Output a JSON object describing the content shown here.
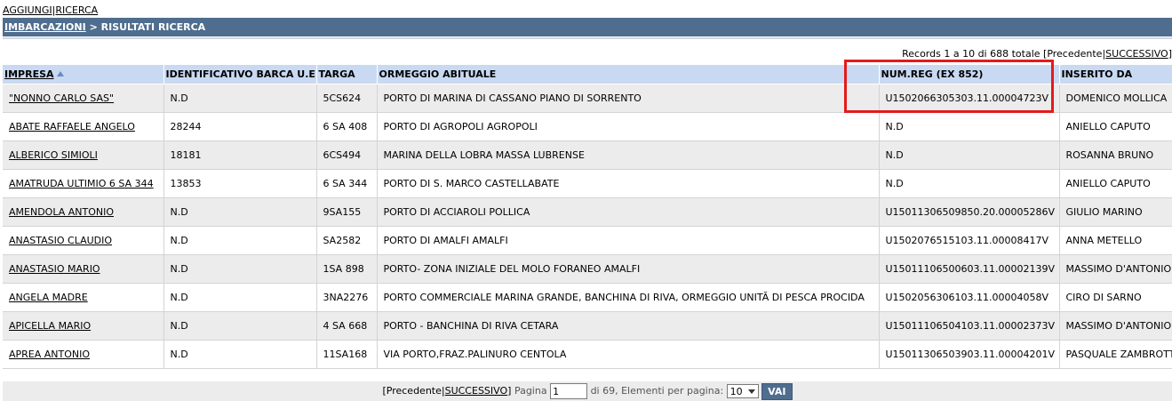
{
  "top_links": {
    "add": "AGGIUNGI",
    "search": "RICERCA"
  },
  "header": {
    "section": "IMBARCAZIONI",
    "separator": ">",
    "title": "RISULTATI RICERCA"
  },
  "records": {
    "summary": "Records 1 a 10 di 688 totale",
    "prev_open": "[Precedente",
    "sep": "|",
    "next": "SUCCESSIVO",
    "close": "]"
  },
  "columns": [
    "IMPRESA",
    "IDENTIFICATIVO BARCA U.E",
    "TARGA",
    "ORMEGGIO ABITUALE",
    "NUM.REG (EX 852)",
    "INSERITO DA"
  ],
  "sort_icon": "sort-ascending-icon",
  "rows": [
    [
      "\"NONNO CARLO SAS\"",
      "N.D",
      "5CS624",
      "PORTO DI MARINA DI CASSANO PIANO DI SORRENTO",
      "U1502066305303.11.00004723V",
      "DOMENICO MOLLICA"
    ],
    [
      "ABATE RAFFAELE ANGELO",
      "28244",
      "6 SA 408",
      "PORTO DI AGROPOLI AGROPOLI",
      "N.D",
      "ANIELLO CAPUTO"
    ],
    [
      "ALBERICO SIMIOLI",
      "18181",
      "6CS494",
      "MARINA DELLA LOBRA MASSA LUBRENSE",
      "N.D",
      "ROSANNA BRUNO"
    ],
    [
      "AMATRUDA ULTIMIO 6 SA 344",
      "13853",
      "6 SA 344",
      "PORTO DI S. MARCO CASTELLABATE",
      "N.D",
      "ANIELLO CAPUTO"
    ],
    [
      "AMENDOLA ANTONIO",
      "N.D",
      "9SA155",
      "PORTO DI ACCIAROLI POLLICA",
      "U15011306509850.20.00005286V",
      "GIULIO MARINO"
    ],
    [
      "ANASTASIO CLAUDIO",
      "N.D",
      "SA2582",
      "PORTO DI AMALFI AMALFI",
      "U1502076515103.11.00008417V",
      "ANNA METELLO"
    ],
    [
      "ANASTASIO MARIO",
      "N.D",
      "1SA 898",
      "PORTO- ZONA INIZIALE DEL MOLO FORANEO AMALFI",
      "U15011106500603.11.00002139V",
      "MASSIMO D'ANTONIO"
    ],
    [
      "ANGELA MADRE",
      "N.D",
      "3NA2276",
      "PORTO COMMERCIALE MARINA GRANDE, BANCHINA DI RIVA, ORMEGGIO UNITÃ  DI PESCA PROCIDA",
      "U1502056306103.11.00004058V",
      "CIRO DI SARNO"
    ],
    [
      "APICELLA MARIO",
      "N.D",
      "4 SA 668",
      "PORTO - BANCHINA DI RIVA CETARA",
      "U15011106504103.11.00002373V",
      "MASSIMO D'ANTONIO"
    ],
    [
      "APREA ANTONIO",
      "N.D",
      "11SA168",
      "VIA PORTO,FRAZ.PALINURO CENTOLA",
      "U15011306503903.11.00004201V",
      "PASQUALE ZAMBROTTA"
    ]
  ],
  "pager": {
    "prev_open": "[Precedente",
    "sep": "|",
    "next": "SUCCESSIVO",
    "close": "]",
    "page_label": "Pagina",
    "page_value": "1",
    "of_label": "di 69, Elementi per pagina:",
    "per_page": "10",
    "go": "VAI"
  },
  "colors": {
    "header_bar": "#4f6d8e",
    "column_header": "#c9d9f2",
    "row_alt": "#ececec",
    "highlight": "#e41b1b"
  }
}
